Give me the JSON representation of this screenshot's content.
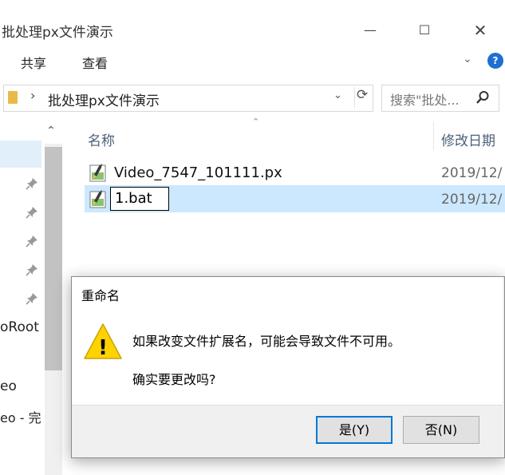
{
  "window": {
    "title": "批处理px文件演示",
    "min_glyph": "—",
    "max_glyph": "☐",
    "close_glyph": "✕"
  },
  "ribbon": {
    "tabs": [
      "共享",
      "查看"
    ],
    "expand_glyph": "⌄",
    "help_glyph": "?"
  },
  "address": {
    "separator": "›",
    "path": "批处理px文件演示",
    "dropdown_glyph": "⌄",
    "refresh_glyph": "⟳",
    "search_placeholder": "搜索\"批处..."
  },
  "nav": {
    "scroll_up_glyph": "⌃",
    "pin_glyph": "📌",
    "items": [
      "oRoot",
      "eo",
      "eo - 完"
    ]
  },
  "columns": {
    "name": "名称",
    "date": "修改日期",
    "sort_glyph": "⌃"
  },
  "files": [
    {
      "name": "Video_7547_101111.px",
      "date": "2019/12/"
    },
    {
      "name": "1.bat",
      "date": "2019/12/",
      "renaming": true
    }
  ],
  "dialog": {
    "title": "重命名",
    "message": "如果改变文件扩展名，可能会导致文件不可用。",
    "question": "确实要更改吗?",
    "yes_label": "是(Y)",
    "no_label": "否(N)",
    "warning_glyph": "!"
  },
  "colors": {
    "accent": "#0078d7",
    "selection": "#cce8ff",
    "warning": "#ffd200"
  }
}
